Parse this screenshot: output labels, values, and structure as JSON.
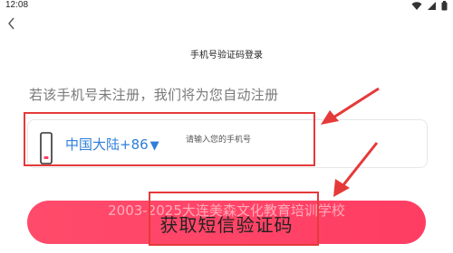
{
  "status_bar": {
    "time": "12:08",
    "icons": [
      "wifi-icon",
      "cellular-signal-icon",
      "battery-icon"
    ]
  },
  "nav": {
    "back_icon": "chevron-left-icon"
  },
  "title": "手机号验证码登录",
  "hint": "若该手机号未注册，我们将为您自动注册",
  "phone_field": {
    "region_label": "中国大陆+86",
    "caret": "▼",
    "placeholder": "请输入您的手机号",
    "value": ""
  },
  "primary_button": {
    "label": "获取短信验证码"
  },
  "watermark": "2003-2025大连美森文化教育培训学校",
  "annotations": {
    "highlight_color": "#e53a3a"
  },
  "colors": {
    "accent": "#ff4064",
    "link": "#2f7ed8"
  }
}
